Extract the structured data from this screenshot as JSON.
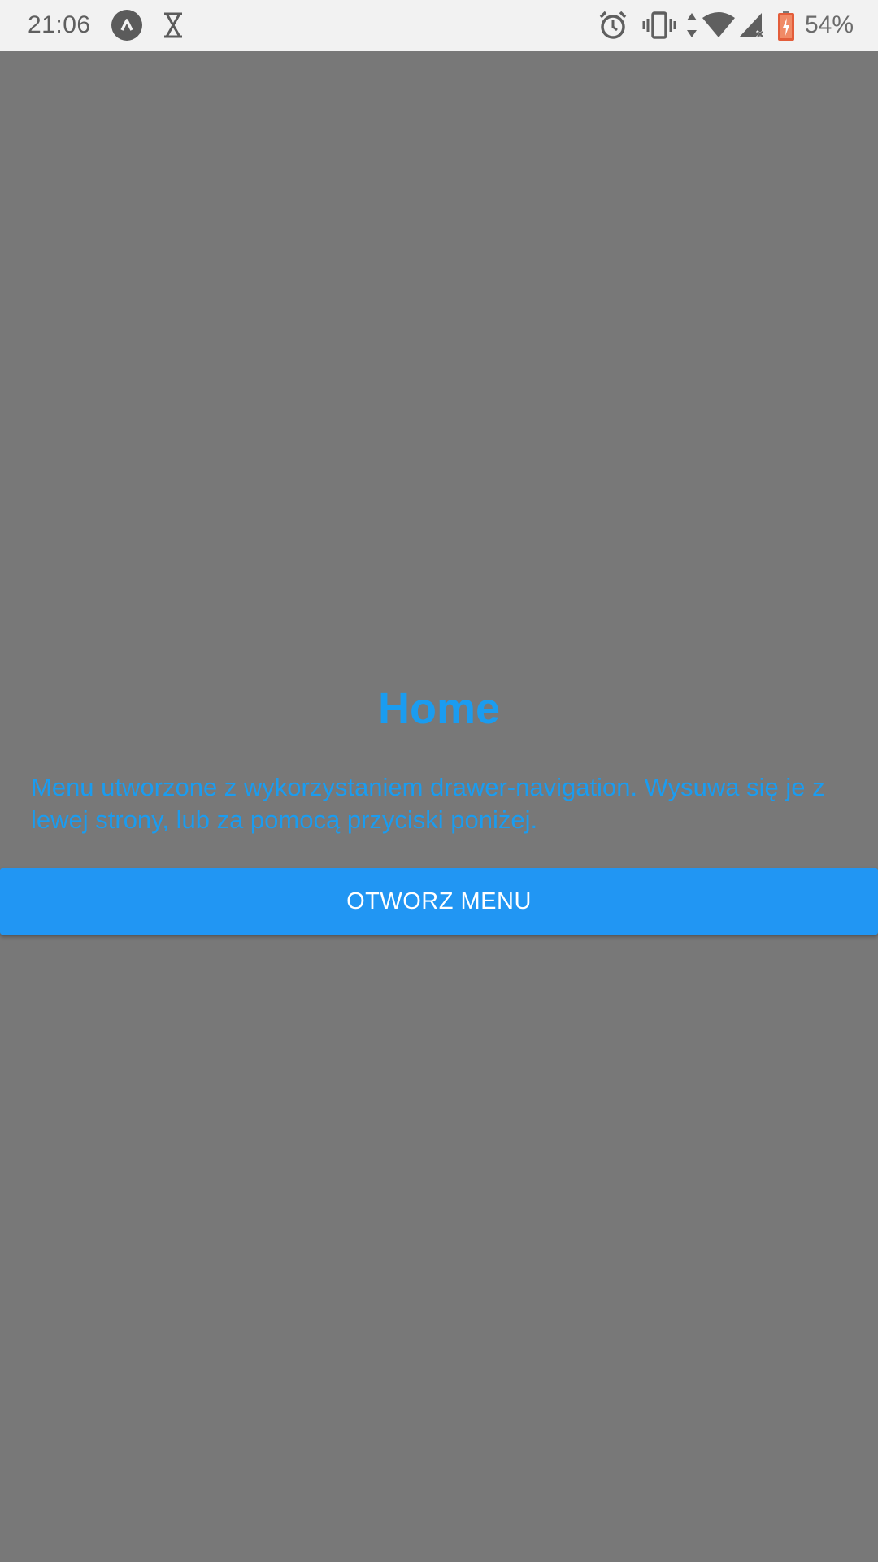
{
  "status_bar": {
    "time": "21:06",
    "battery_percent": "54%",
    "icons": [
      "app-notification-icon",
      "hourglass-icon",
      "alarm-icon",
      "vibrate-icon",
      "data-arrows-icon",
      "wifi-icon",
      "cell-signal-icon",
      "battery-icon"
    ],
    "background_color": "#f2f2f2"
  },
  "main": {
    "title": "Home",
    "description": "Menu utworzone z wykorzystaniem drawer-navigation. Wysuwa się je z lewej strony, lub za pomocą przyciski poniżej.",
    "button_label": "OTWORZ MENU",
    "background_color": "#787878",
    "accent_color": "#1a9cf0",
    "button_color": "#2196f3"
  }
}
